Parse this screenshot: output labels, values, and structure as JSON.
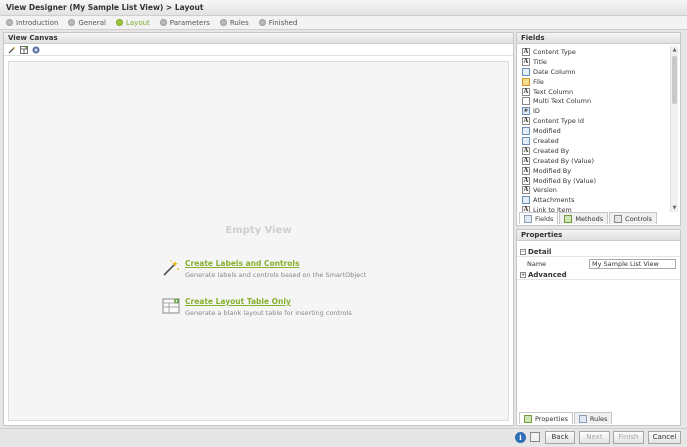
{
  "window": {
    "title": "View Designer (My Sample List View) > Layout"
  },
  "steps": [
    {
      "label": "Introduction",
      "active": false
    },
    {
      "label": "General",
      "active": false
    },
    {
      "label": "Layout",
      "active": true
    },
    {
      "label": "Parameters",
      "active": false
    },
    {
      "label": "Rules",
      "active": false
    },
    {
      "label": "Finished",
      "active": false
    }
  ],
  "canvas": {
    "title": "View Canvas",
    "empty_title": "Empty View",
    "actions": [
      {
        "label": "Create Labels and Controls",
        "description": "Generate labels and controls based on the SmartObject"
      },
      {
        "label": "Create Layout Table Only",
        "description": "Generate a blank layout table for inserting controls"
      }
    ]
  },
  "fields": {
    "title": "Fields",
    "items": [
      {
        "label": "Content Type",
        "icon": "text-field-icon",
        "glyph": "A"
      },
      {
        "label": "Title",
        "icon": "text-field-icon",
        "glyph": "A"
      },
      {
        "label": "Date Column",
        "icon": "date-field-icon",
        "glyph": ""
      },
      {
        "label": "File",
        "icon": "file-field-icon",
        "glyph": ""
      },
      {
        "label": "Text Column",
        "icon": "text-field-icon",
        "glyph": "A"
      },
      {
        "label": "Multi Text Column",
        "icon": "multi-text-field-icon",
        "glyph": ""
      },
      {
        "label": "ID",
        "icon": "id-field-icon",
        "glyph": "#"
      },
      {
        "label": "Content Type Id",
        "icon": "text-field-icon",
        "glyph": "A"
      },
      {
        "label": "Modified",
        "icon": "date-field-icon",
        "glyph": ""
      },
      {
        "label": "Created",
        "icon": "date-field-icon",
        "glyph": ""
      },
      {
        "label": "Created By",
        "icon": "text-field-icon",
        "glyph": "A"
      },
      {
        "label": "Created By (Value)",
        "icon": "text-field-icon",
        "glyph": "A"
      },
      {
        "label": "Modified By",
        "icon": "text-field-icon",
        "glyph": "A"
      },
      {
        "label": "Modified By (Value)",
        "icon": "text-field-icon",
        "glyph": "A"
      },
      {
        "label": "Version",
        "icon": "text-field-icon",
        "glyph": "A"
      },
      {
        "label": "Attachments",
        "icon": "date-field-icon",
        "glyph": ""
      },
      {
        "label": "Link to Item",
        "icon": "text-field-icon",
        "glyph": "A"
      }
    ],
    "tabs": [
      {
        "label": "Fields",
        "active": true
      },
      {
        "label": "Methods",
        "active": false
      },
      {
        "label": "Controls",
        "active": false
      }
    ]
  },
  "properties": {
    "title": "Properties",
    "sections": {
      "detail": {
        "toggle": "−",
        "label": "Detail"
      },
      "advanced": {
        "toggle": "+",
        "label": "Advanced"
      }
    },
    "rows": [
      {
        "name": "Name",
        "value": "My Sample List View"
      }
    ],
    "tabs": [
      {
        "label": "Properties",
        "active": true
      },
      {
        "label": "Rules",
        "active": false
      }
    ]
  },
  "footer": {
    "info_glyph": "i",
    "back": "Back",
    "next": "Next",
    "finish": "Finish",
    "cancel": "Cancel"
  }
}
